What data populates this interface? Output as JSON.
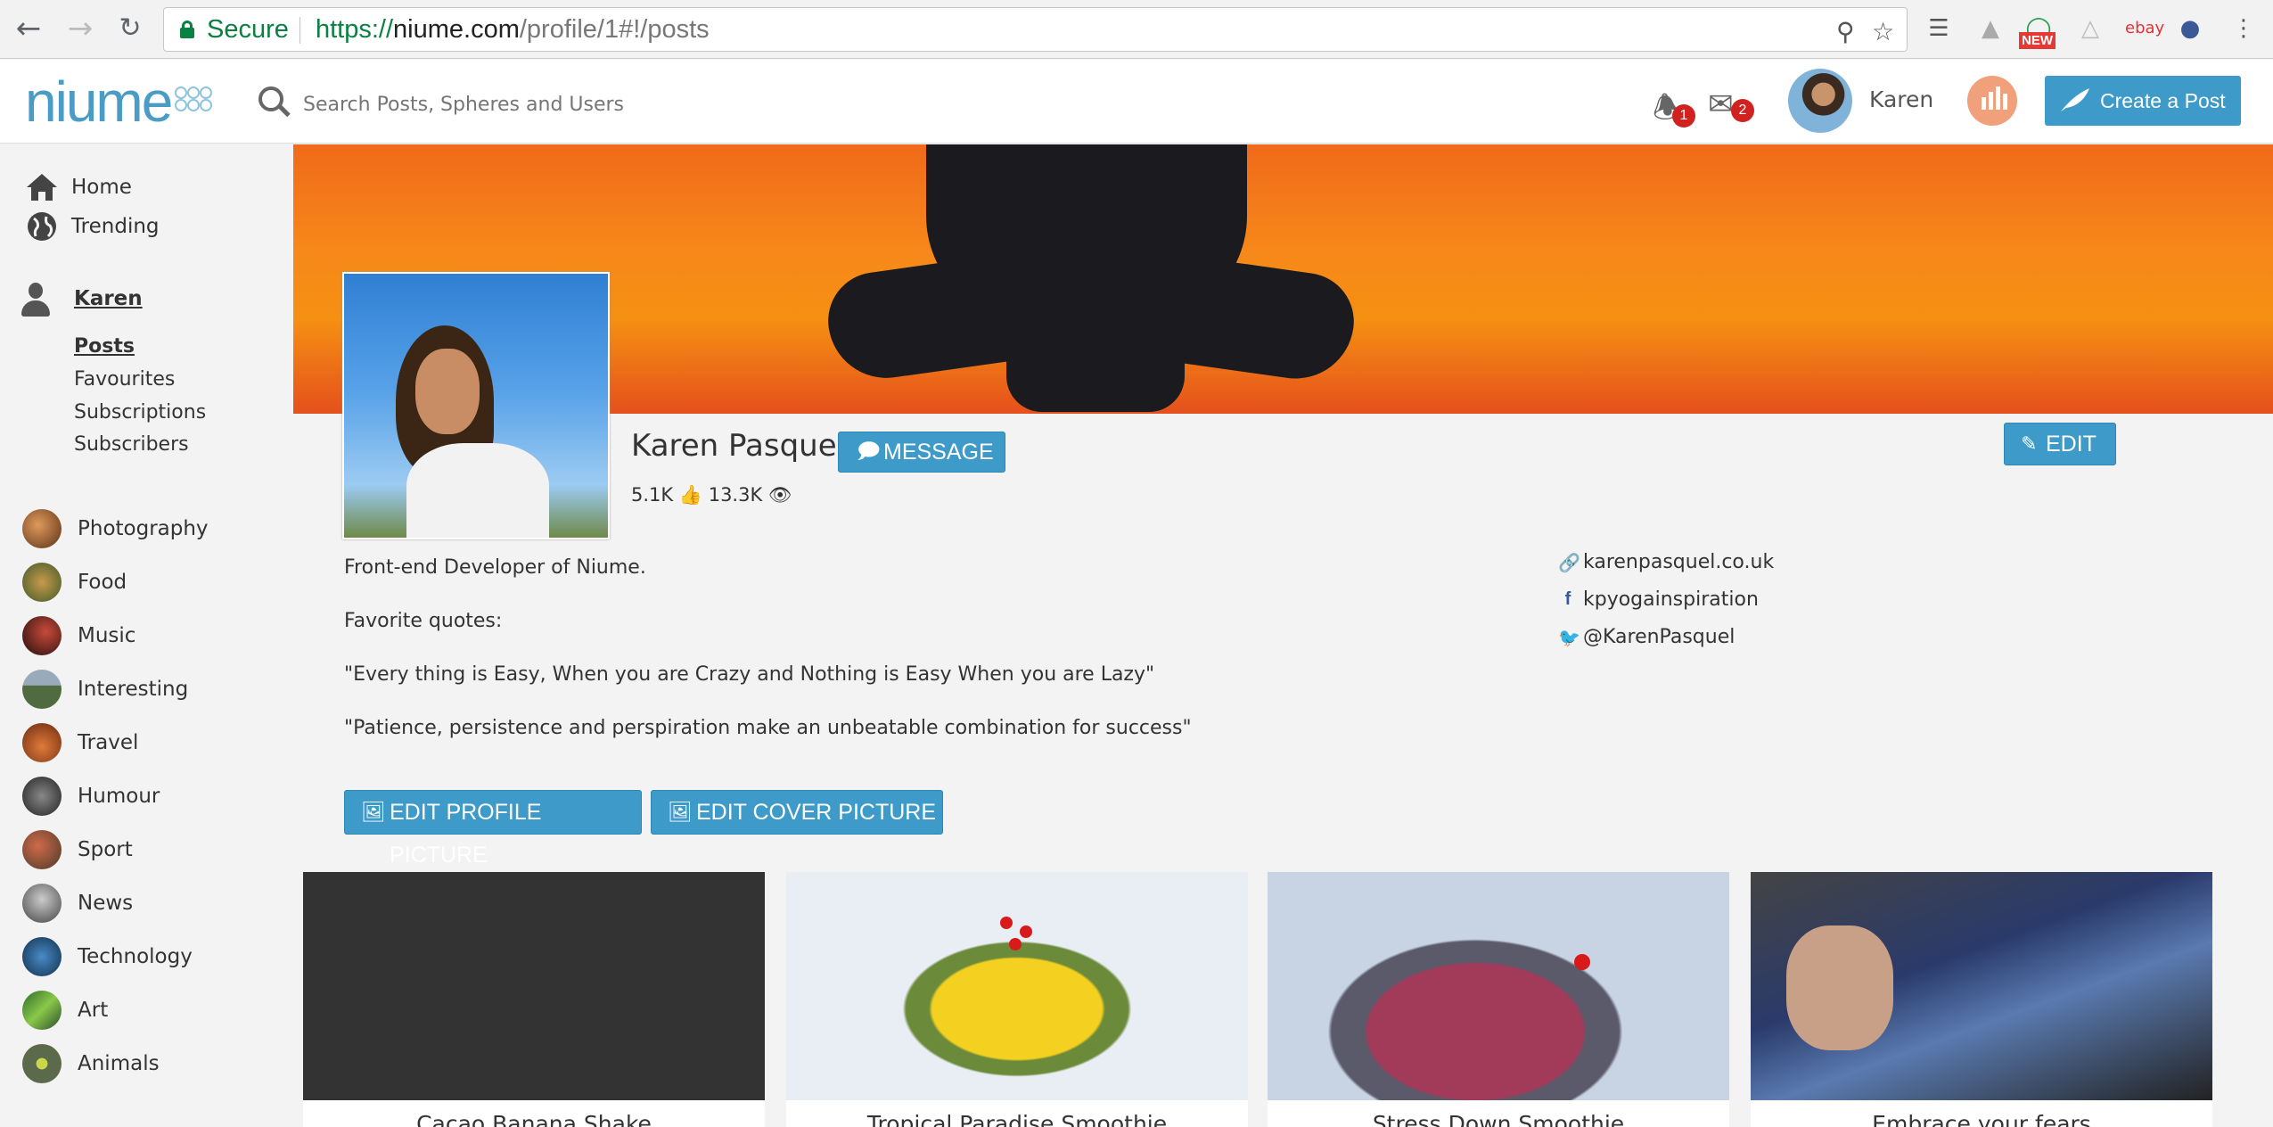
{
  "browser": {
    "secure_label": "Secure",
    "url_scheme": "https://",
    "url_host": "niume.com",
    "url_path": "/profile/1#!/posts",
    "ext_new_badge": "NEW"
  },
  "header": {
    "logo": "niume",
    "search_placeholder": "Search Posts, Spheres and Users",
    "notifications_count": "1",
    "messages_count": "2",
    "user_name": "Karen",
    "create_post_label": "Create a Post"
  },
  "sidebar": {
    "main_nav": [
      {
        "label": "Home",
        "icon": "home-icon"
      },
      {
        "label": "Trending",
        "icon": "globe-icon"
      }
    ],
    "profile_name": "Karen",
    "profile_links": [
      {
        "label": "Posts",
        "active": true
      },
      {
        "label": "Favourites"
      },
      {
        "label": "Subscriptions"
      },
      {
        "label": "Subscribers"
      }
    ],
    "spheres": [
      {
        "label": "Photography",
        "color": "#7a4a2a"
      },
      {
        "label": "Food",
        "color": "#5a6b3a"
      },
      {
        "label": "Music",
        "color": "#3b1e1e"
      },
      {
        "label": "Interesting",
        "color": "#4f6b3f"
      },
      {
        "label": "Travel",
        "color": "#a4451f"
      },
      {
        "label": "Humour",
        "color": "#3a3a3a"
      },
      {
        "label": "Sport",
        "color": "#8b3b2a"
      },
      {
        "label": "News",
        "color": "#6b6b6b"
      },
      {
        "label": "Technology",
        "color": "#2a5a8a"
      },
      {
        "label": "Art",
        "color": "#3a7a3a"
      },
      {
        "label": "Animals",
        "color": "#5a6a4a"
      }
    ]
  },
  "profile": {
    "name": "Karen Pasquel",
    "message_label": "MESSAGE",
    "edit_label": "EDIT",
    "likes": "5.1K",
    "views": "13.3K",
    "bio_lines": [
      "Front-end Developer of Niume.",
      "Favorite quotes:",
      "\"Every thing is Easy, When you are Crazy and Nothing is Easy When you are Lazy\"",
      "\"Patience, persistence and perspiration make an unbeatable combination for success\""
    ],
    "website": "karenpasquel.co.uk",
    "facebook": "kpyogainspiration",
    "twitter": "@KarenPasquel",
    "edit_profile_picture_label": "EDIT PROFILE PICTURE",
    "edit_cover_picture_label": "EDIT COVER PICTURE"
  },
  "posts": [
    {
      "title": "Cacao Banana Shake"
    },
    {
      "title": "Tropical Paradise Smoothie"
    },
    {
      "title": "Stress Down Smoothie"
    },
    {
      "title": "Embrace your fears"
    }
  ]
}
